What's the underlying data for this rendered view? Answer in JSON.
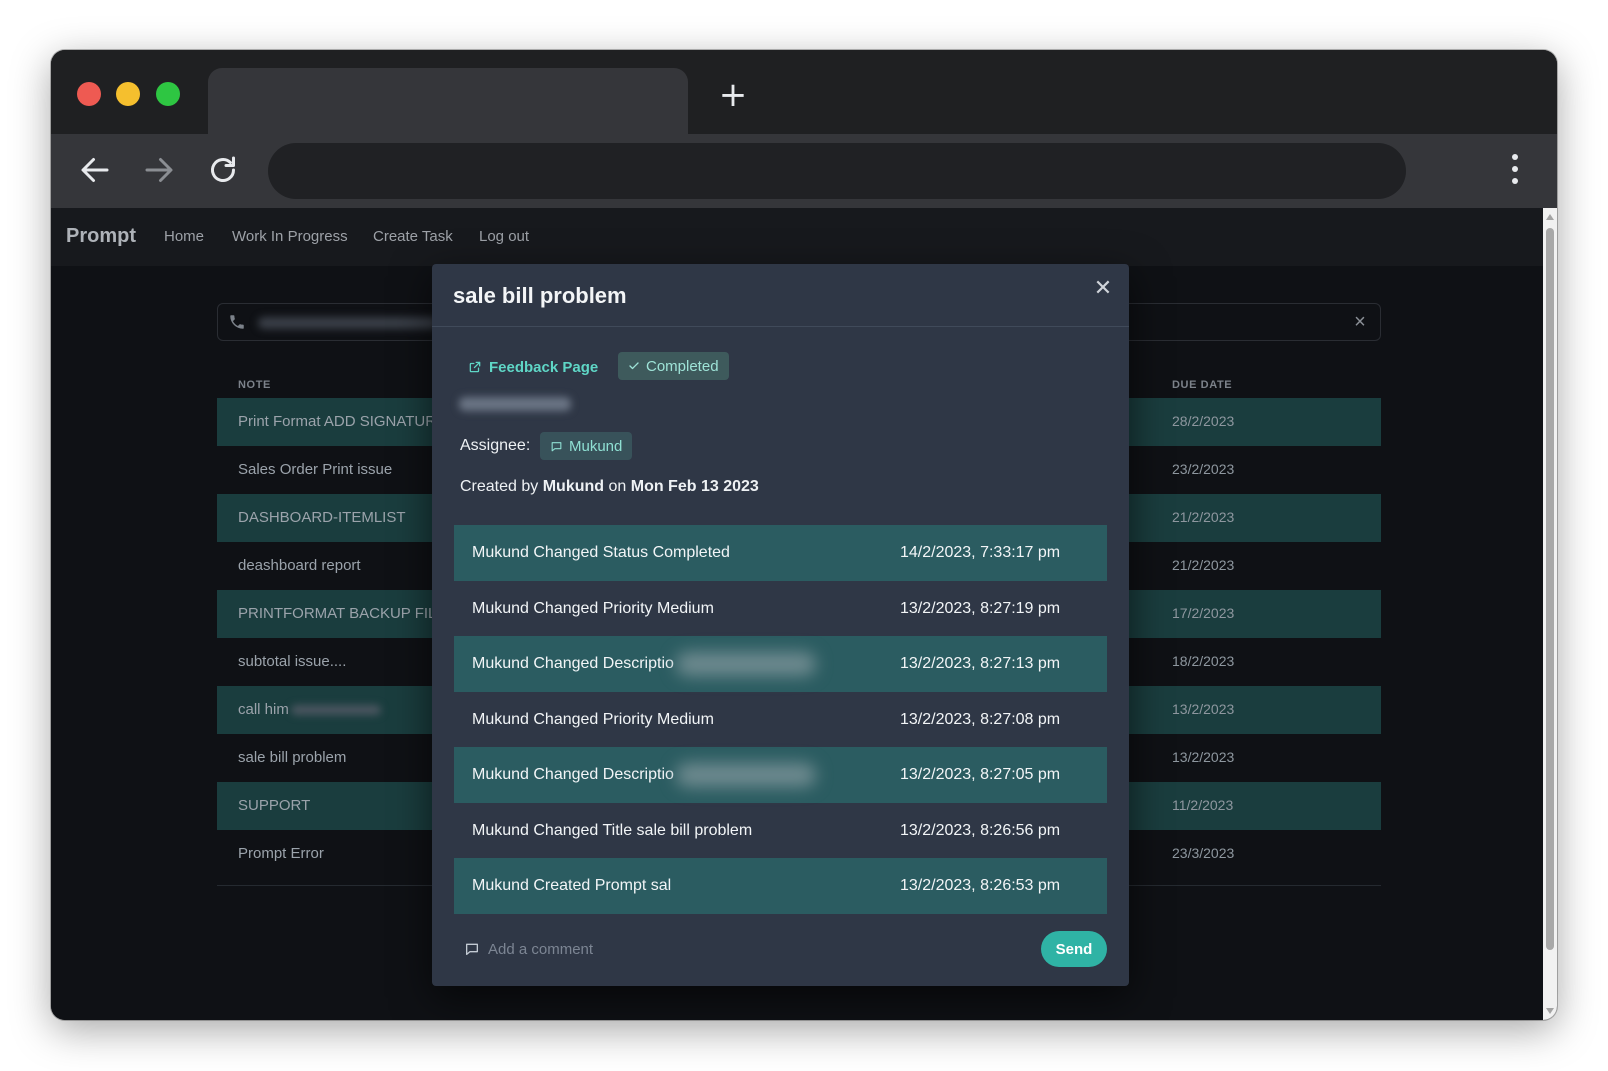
{
  "browser": {
    "tab_title": "",
    "new_tab_symbol": "+",
    "address": ""
  },
  "app": {
    "brand": "Prompt",
    "nav": [
      "Home",
      "Work In Progress",
      "Create Task",
      "Log out"
    ]
  },
  "table": {
    "headers": {
      "note": "NOTE",
      "due_date": "DUE DATE"
    },
    "rows": [
      {
        "note": "Print Format ADD SIGNATURE",
        "due": "28/2/2023",
        "highlight": true
      },
      {
        "note": "Sales Order Print issue",
        "due": "23/2/2023",
        "highlight": false
      },
      {
        "note": "DASHBOARD-ITEMLIST",
        "due": "21/2/2023",
        "highlight": true
      },
      {
        "note": "deashboard report",
        "due": "21/2/2023",
        "highlight": false
      },
      {
        "note": "PRINTFORMAT BACKUP FILE",
        "due": "17/2/2023",
        "highlight": true
      },
      {
        "note": "subtotal issue....",
        "due": "18/2/2023",
        "highlight": false
      },
      {
        "note": "call him",
        "due": "13/2/2023",
        "highlight": true
      },
      {
        "note": "sale bill problem",
        "due": "13/2/2023",
        "highlight": false
      },
      {
        "note": "SUPPORT",
        "due": "11/2/2023",
        "highlight": true
      },
      {
        "note": "Prompt Error",
        "due": "23/3/2023",
        "highlight": false
      }
    ]
  },
  "modal": {
    "title": "sale bill problem",
    "close_symbol": "✕",
    "feedback_link": "Feedback Page",
    "status": "Completed",
    "assignee_label": "Assignee:",
    "assignee": "Mukund",
    "created": {
      "prefix": "Created by ",
      "user": "Mukund",
      "middle": " on ",
      "date": "Mon Feb 13 2023"
    },
    "activity": [
      {
        "text": "Mukund Changed Status Completed",
        "time": "14/2/2023, 7:33:17 pm",
        "highlight": true
      },
      {
        "text": "Mukund Changed Priority Medium",
        "time": "13/2/2023, 8:27:19 pm",
        "highlight": false
      },
      {
        "text": "Mukund Changed Descriptio",
        "time": "13/2/2023, 8:27:13 pm",
        "highlight": true,
        "blurred": true
      },
      {
        "text": "Mukund Changed Priority Medium",
        "time": "13/2/2023, 8:27:08 pm",
        "highlight": false
      },
      {
        "text": "Mukund Changed Descriptio",
        "time": "13/2/2023, 8:27:05 pm",
        "highlight": true,
        "blurred": true
      },
      {
        "text": "Mukund Changed Title sale bill problem",
        "time": "13/2/2023, 8:26:56 pm",
        "highlight": false
      },
      {
        "text": "Mukund Created Prompt sal",
        "time": "13/2/2023, 8:26:53 pm",
        "highlight": true
      }
    ],
    "comment_placeholder": "Add a comment",
    "send_label": "Send"
  },
  "colors": {
    "accent": "#2fb3a5",
    "row_highlight": "#1a3d3e",
    "activity_highlight": "#2b5c61",
    "modal_bg": "#2f3746"
  },
  "icons": {
    "back": "arrow-left-icon",
    "forward": "arrow-right-icon",
    "reload": "reload-icon",
    "menu": "vertical-dots-icon",
    "phone": "phone-icon",
    "clear": "close-icon",
    "external": "external-link-icon",
    "check": "check-icon",
    "chat": "chat-bubble-icon"
  }
}
